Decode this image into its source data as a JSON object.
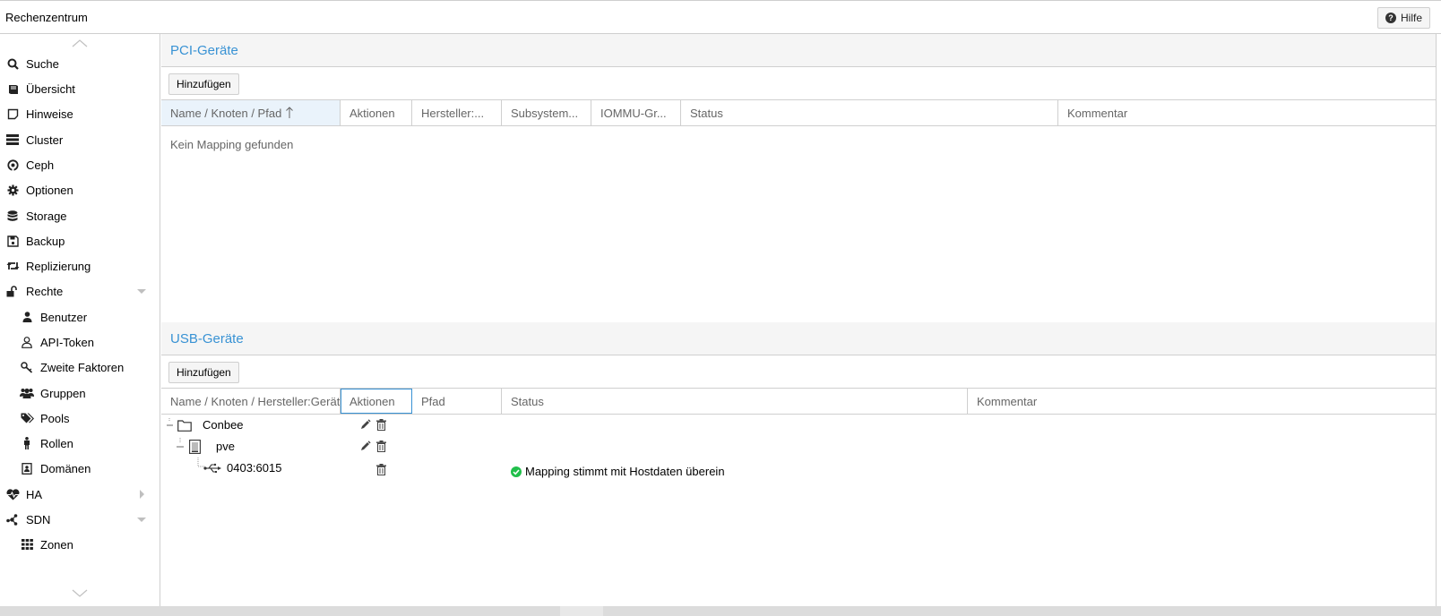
{
  "header": {
    "title": "Rechenzentrum",
    "help_label": "Hilfe"
  },
  "sidebar": {
    "items": [
      {
        "label": "Suche",
        "icon": "search-icon"
      },
      {
        "label": "Übersicht",
        "icon": "book-icon"
      },
      {
        "label": "Hinweise",
        "icon": "note-icon"
      },
      {
        "label": "Cluster",
        "icon": "server-icon"
      },
      {
        "label": "Ceph",
        "icon": "ceph-icon"
      },
      {
        "label": "Optionen",
        "icon": "gear-icon"
      },
      {
        "label": "Storage",
        "icon": "database-icon"
      },
      {
        "label": "Backup",
        "icon": "floppy-icon"
      },
      {
        "label": "Replizierung",
        "icon": "retweet-icon"
      },
      {
        "label": "Rechte",
        "icon": "unlock-icon",
        "expanded": true
      },
      {
        "label": "Benutzer",
        "icon": "user-icon"
      },
      {
        "label": "API-Token",
        "icon": "user-outline-icon"
      },
      {
        "label": "Zweite Faktoren",
        "icon": "key-icon"
      },
      {
        "label": "Gruppen",
        "icon": "users-icon"
      },
      {
        "label": "Pools",
        "icon": "tags-icon"
      },
      {
        "label": "Rollen",
        "icon": "male-icon"
      },
      {
        "label": "Domänen",
        "icon": "address-book-icon"
      },
      {
        "label": "HA",
        "icon": "heartbeat-icon",
        "expanded": false
      },
      {
        "label": "SDN",
        "icon": "sdn-icon",
        "expanded": true
      },
      {
        "label": "Zonen",
        "icon": "grid-icon"
      }
    ]
  },
  "pci": {
    "title": "PCI-Geräte",
    "add_label": "Hinzufügen",
    "columns": [
      "Name / Knoten / Pfad",
      "Aktionen",
      "Hersteller:...",
      "Subsystem...",
      "IOMMU-Gr...",
      "Status",
      "Kommentar"
    ],
    "empty_text": "Kein Mapping gefunden"
  },
  "usb": {
    "title": "USB-Geräte",
    "add_label": "Hinzufügen",
    "columns": [
      "Name / Knoten / Hersteller:Gerät",
      "Aktionen",
      "Pfad",
      "Status",
      "Kommentar"
    ],
    "rows": [
      {
        "name": "Conbee",
        "icon": "folder-icon"
      },
      {
        "name": "pve",
        "icon": "node-icon"
      },
      {
        "name": "0403:6015",
        "icon": "usb-icon",
        "status": "Mapping stimmt mit Hostdaten überein"
      }
    ]
  },
  "colors": {
    "accent": "#3892d4",
    "ok": "#21bf4b"
  }
}
